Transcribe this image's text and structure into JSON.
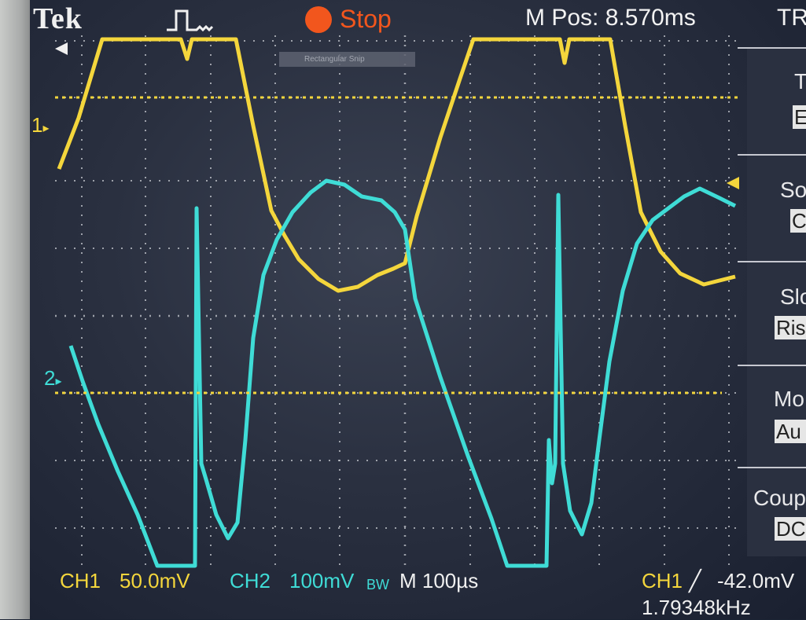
{
  "header": {
    "brand": "Tek",
    "acquisition_state": "Stop",
    "horizontal_position": "M Pos: 8.570ms",
    "side_menu_title": "TR"
  },
  "overlay": {
    "snip_label": "Rectangular Snip"
  },
  "markers": {
    "ch1_ground": "1",
    "ch2_ground": "2"
  },
  "side_menu": {
    "items": [
      {
        "label": "T",
        "value": "E"
      },
      {
        "label": "So",
        "value": "C"
      },
      {
        "label": "Slo",
        "value": "Ris"
      },
      {
        "label": "Mo",
        "value": "Au"
      },
      {
        "label": "Coupl",
        "value": "DC"
      }
    ]
  },
  "footer": {
    "ch1_label": "CH1",
    "ch1_scale": "50.0mV",
    "ch2_label": "CH2",
    "ch2_scale": "100mV",
    "ch2_bw": "BW",
    "timebase": "M 100µs",
    "trigger_source": "CH1",
    "trigger_slope_symbol": "╱",
    "trigger_level": "-42.0mV",
    "frequency": "1.79348kHz"
  },
  "colors": {
    "ch1": "#f4d63c",
    "ch2": "#3fdcd6",
    "stop": "#f2561d",
    "grid": "#cfd2d8"
  }
}
